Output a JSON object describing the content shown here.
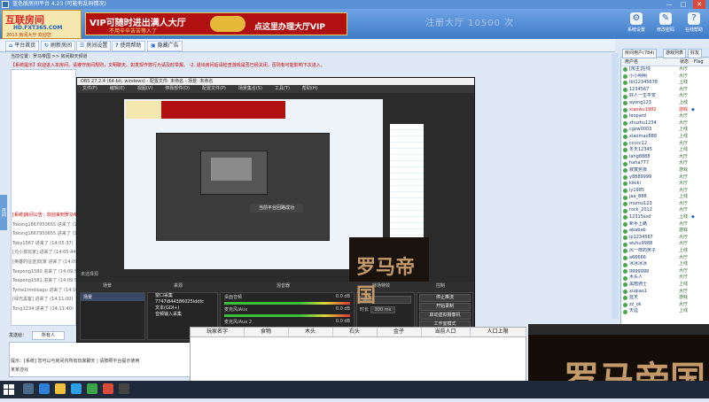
{
  "window": {
    "title": "蓝色版房间平台 4.23 (可能有乱码情况)",
    "min": "—",
    "max": "□",
    "close": "✕"
  },
  "logo": {
    "big": "互联房间",
    "url": "HD.FXT365.COM",
    "slogan": "2013 房间大厅 欢迎您"
  },
  "banner": {
    "line1": "VIP可随时进出满人大厅",
    "line2": "不用辛辛苦苦等人了",
    "line3": "点这里办理大厅VIP"
  },
  "header_ghost": "注册大厅 10500 次",
  "toolbar": [
    {
      "label": "系统设置",
      "icon": "⚙"
    },
    {
      "label": "修改密码",
      "icon": "✎"
    },
    {
      "label": "在线帮助",
      "icon": "?"
    }
  ],
  "nav": [
    {
      "label": "平台首页",
      "icon": "⌂"
    },
    {
      "label": "刷新房间",
      "icon": "↻"
    },
    {
      "label": "房间设置",
      "icon": "☰"
    },
    {
      "label": "使用帮助",
      "icon": "?"
    },
    {
      "label": "隐藏广告",
      "icon": "▣"
    }
  ],
  "breadcrumb": "当前位置：罗马帝国 >> 房间聊天频道",
  "notice": "【系统提示】欢迎进入本房间，请遵守房间规则，文明聊天。如发现作弊行为请及时举报。 -2. 退出房间后请检查游戏是否已经关闭，否则有可能影响下次进入。",
  "messages": [
    "[系统]房间公告：欢迎来到罗马帝国房间",
    "Tokong1667950655 进来了 (14:05:07)",
    "Tokong1667950655 进来了 (14:05:11)",
    "Toby1567 进来了 (14:05:37)",
    "[元小孩玩家] 进来了 (14:05:44)",
    "[英雄的征途]玩家 进来了 (14:09:06)",
    "Teapong1580 进来了 (14:09:50)",
    "Teapong1581 进来了 (14:09:51)",
    "Tyme1tmdisagu 进来了 (14:10:31)",
    "[绿光黑客] 进来了 (14:11:00)",
    "Tong1234 进来了 (14:11:40)"
  ],
  "input": {
    "label": "发送给：",
    "value": "所有人"
  },
  "status": "提示：[系统] 您可以与房间内所有玩家聊天  |  请按照平台提示使用",
  "bottom_text": "某某游戏",
  "userlist": {
    "tabs": [
      "房间用户(784)",
      "游戏列表",
      "好友"
    ],
    "headers": [
      "用户名",
      "状态",
      "Flag"
    ],
    "users": [
      {
        "name": "[房主]在线",
        "status": "大厅",
        "flag": "",
        "red": false
      },
      {
        "name": "小小明明",
        "status": "大厅",
        "flag": "",
        "red": false
      },
      {
        "name": "lbt12345678",
        "status": "上线",
        "flag": "",
        "red": false
      },
      {
        "name": "1234567",
        "status": "大厅",
        "flag": "",
        "red": false
      },
      {
        "name": "好人一生平安",
        "status": "大厅",
        "flag": "",
        "red": false
      },
      {
        "name": "ayong123",
        "status": "上线",
        "flag": "",
        "red": false
      },
      {
        "name": "xiaowu1982",
        "status": "游戏",
        "flag": "◆",
        "red": true
      },
      {
        "name": "leopard",
        "status": "大厅",
        "flag": "",
        "red": false
      },
      {
        "name": "zhuzhu1234",
        "status": "大厅",
        "flag": "",
        "red": false
      },
      {
        "name": "cgzw0003",
        "status": "上线",
        "flag": "",
        "red": false
      },
      {
        "name": "xiaomao888",
        "status": "上线",
        "flag": "",
        "red": false
      },
      {
        "name": "ccccc12",
        "status": "大厅",
        "flag": "",
        "red": false
      },
      {
        "name": "冬天12345",
        "status": "上线",
        "flag": "",
        "red": false
      },
      {
        "name": "lang8888",
        "status": "大厅",
        "flag": "",
        "red": false
      },
      {
        "name": "haha777",
        "status": "大厅",
        "flag": "",
        "red": false
      },
      {
        "name": "寂寞男孩",
        "status": "游戏",
        "flag": "",
        "red": false
      },
      {
        "name": "y8889999",
        "status": "大厅",
        "flag": "",
        "red": false
      },
      {
        "name": "kikiki",
        "status": "大厅",
        "flag": "",
        "red": false
      },
      {
        "name": "ly1985",
        "status": "大厅",
        "flag": "",
        "red": false
      },
      {
        "name": "jaa_888",
        "status": "上线",
        "flag": "",
        "red": false
      },
      {
        "name": "mumu123",
        "status": "大厅",
        "flag": "",
        "red": false
      },
      {
        "name": "rock_2012",
        "status": "大厅",
        "flag": "",
        "red": false
      },
      {
        "name": "12315ssd",
        "status": "上线",
        "flag": "◆",
        "red": false
      },
      {
        "name": "新手上路",
        "status": "大厅",
        "flag": "",
        "red": false
      },
      {
        "name": "ababab",
        "status": "游戏",
        "flag": "",
        "red": false
      },
      {
        "name": "lp1234567",
        "status": "大厅",
        "flag": "",
        "red": false
      },
      {
        "name": "wuhu9988",
        "status": "大厅",
        "flag": "",
        "red": false
      },
      {
        "name": "风一样的男子",
        "status": "上线",
        "flag": "",
        "red": false
      },
      {
        "name": "a66666",
        "status": "大厅",
        "flag": "",
        "red": false
      },
      {
        "name": "冰冰冰冰",
        "status": "上线",
        "flag": "",
        "red": false
      },
      {
        "name": "ggggggg",
        "status": "大厅",
        "flag": "",
        "red": false
      },
      {
        "name": "木头人",
        "status": "大厅",
        "flag": "",
        "red": false
      },
      {
        "name": "黑暗骑士",
        "status": "上线",
        "flag": "",
        "red": false
      },
      {
        "name": "xuqiao1",
        "status": "大厅",
        "flag": "",
        "red": false
      },
      {
        "name": "蓝天",
        "status": "游戏",
        "flag": "",
        "red": false
      },
      {
        "name": "zz_ok",
        "status": "大厅",
        "flag": "",
        "red": false
      },
      {
        "name": "天涯",
        "status": "上线",
        "flag": "",
        "red": false
      }
    ]
  },
  "obs": {
    "title": "OBS 27.2.4 (64-bit, windows) - 配置文件: 未命名 - 场景: 未命名",
    "menu": [
      "文件(F)",
      "编辑(E)",
      "视图(V)",
      "停靠部件(D)",
      "配置文件(P)",
      "场景集合(S)",
      "工具(T)",
      "帮助(H)"
    ],
    "preview_msg": "当前平台回路成功",
    "mixer_bar": "未选择源",
    "dock": {
      "scenes": "场景",
      "sources": "来源",
      "mixer": "混音器",
      "transitions": "转场特效",
      "controls": "控制"
    },
    "scene_item": "场景",
    "sources": [
      "窗口采集",
      "7747i844386025lddfc",
      "文本(GDI+)",
      "音频输入采集"
    ],
    "mixer_tracks": [
      {
        "name": "桌面音频",
        "db": "0.0 dB"
      },
      {
        "name": "麦克风/Aux",
        "db": "0.0 dB"
      },
      {
        "name": "麦克风/Aux 2",
        "db": "0.0 dB"
      }
    ],
    "transition": {
      "type": "淡出",
      "duration_label": "时长",
      "duration": "300 ms"
    },
    "controls": [
      "停止推流",
      "开始录制",
      "启动虚拟摄像机",
      "工作室模式",
      "设置",
      "退出"
    ]
  },
  "overlay_text": "罗马帝国",
  "table_headers": [
    "玩家名字",
    "食物",
    "木头",
    "石头",
    "金子",
    "当前人口",
    "人口上限"
  ]
}
